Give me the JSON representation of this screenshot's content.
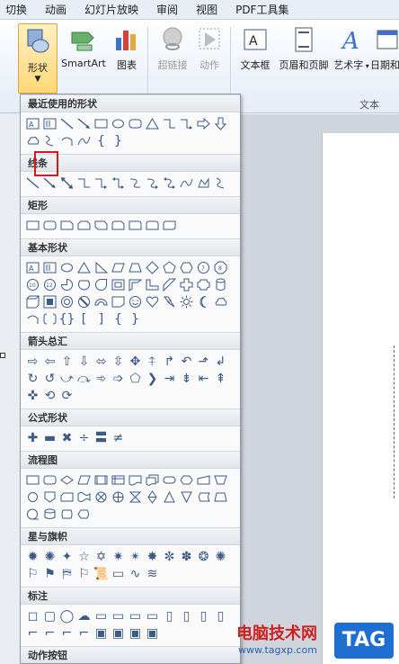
{
  "tabs": [
    "切换",
    "动画",
    "幻灯片放映",
    "审阅",
    "视图",
    "PDF工具集"
  ],
  "ribbon": {
    "shapes_label": "形状",
    "smartart_label": "SmartArt",
    "chart_label": "图表",
    "hyperlink_label": "超链接",
    "action_label": "动作",
    "textbox_label": "文本框",
    "header_footer_label": "页眉和页脚",
    "wordart_label": "艺术字",
    "date_label": "日期和",
    "text_group_label": "文本"
  },
  "sections": [
    {
      "title": "最近使用的形状"
    },
    {
      "title": "线条"
    },
    {
      "title": "矩形"
    },
    {
      "title": "基本形状"
    },
    {
      "title": "箭头总汇"
    },
    {
      "title": "公式形状"
    },
    {
      "title": "流程图"
    },
    {
      "title": "星与旗帜"
    },
    {
      "title": "标注"
    },
    {
      "title": "动作按钮"
    }
  ],
  "selected_shape": "oval-shape",
  "watermark": {
    "title": "电脑技术网",
    "url": "www.tagxp.com",
    "tag": "TAG"
  },
  "colors": {
    "highlight": "#e0151b",
    "shape_button_bg": "#ffd777",
    "icon_blue": "#3b5a86"
  }
}
